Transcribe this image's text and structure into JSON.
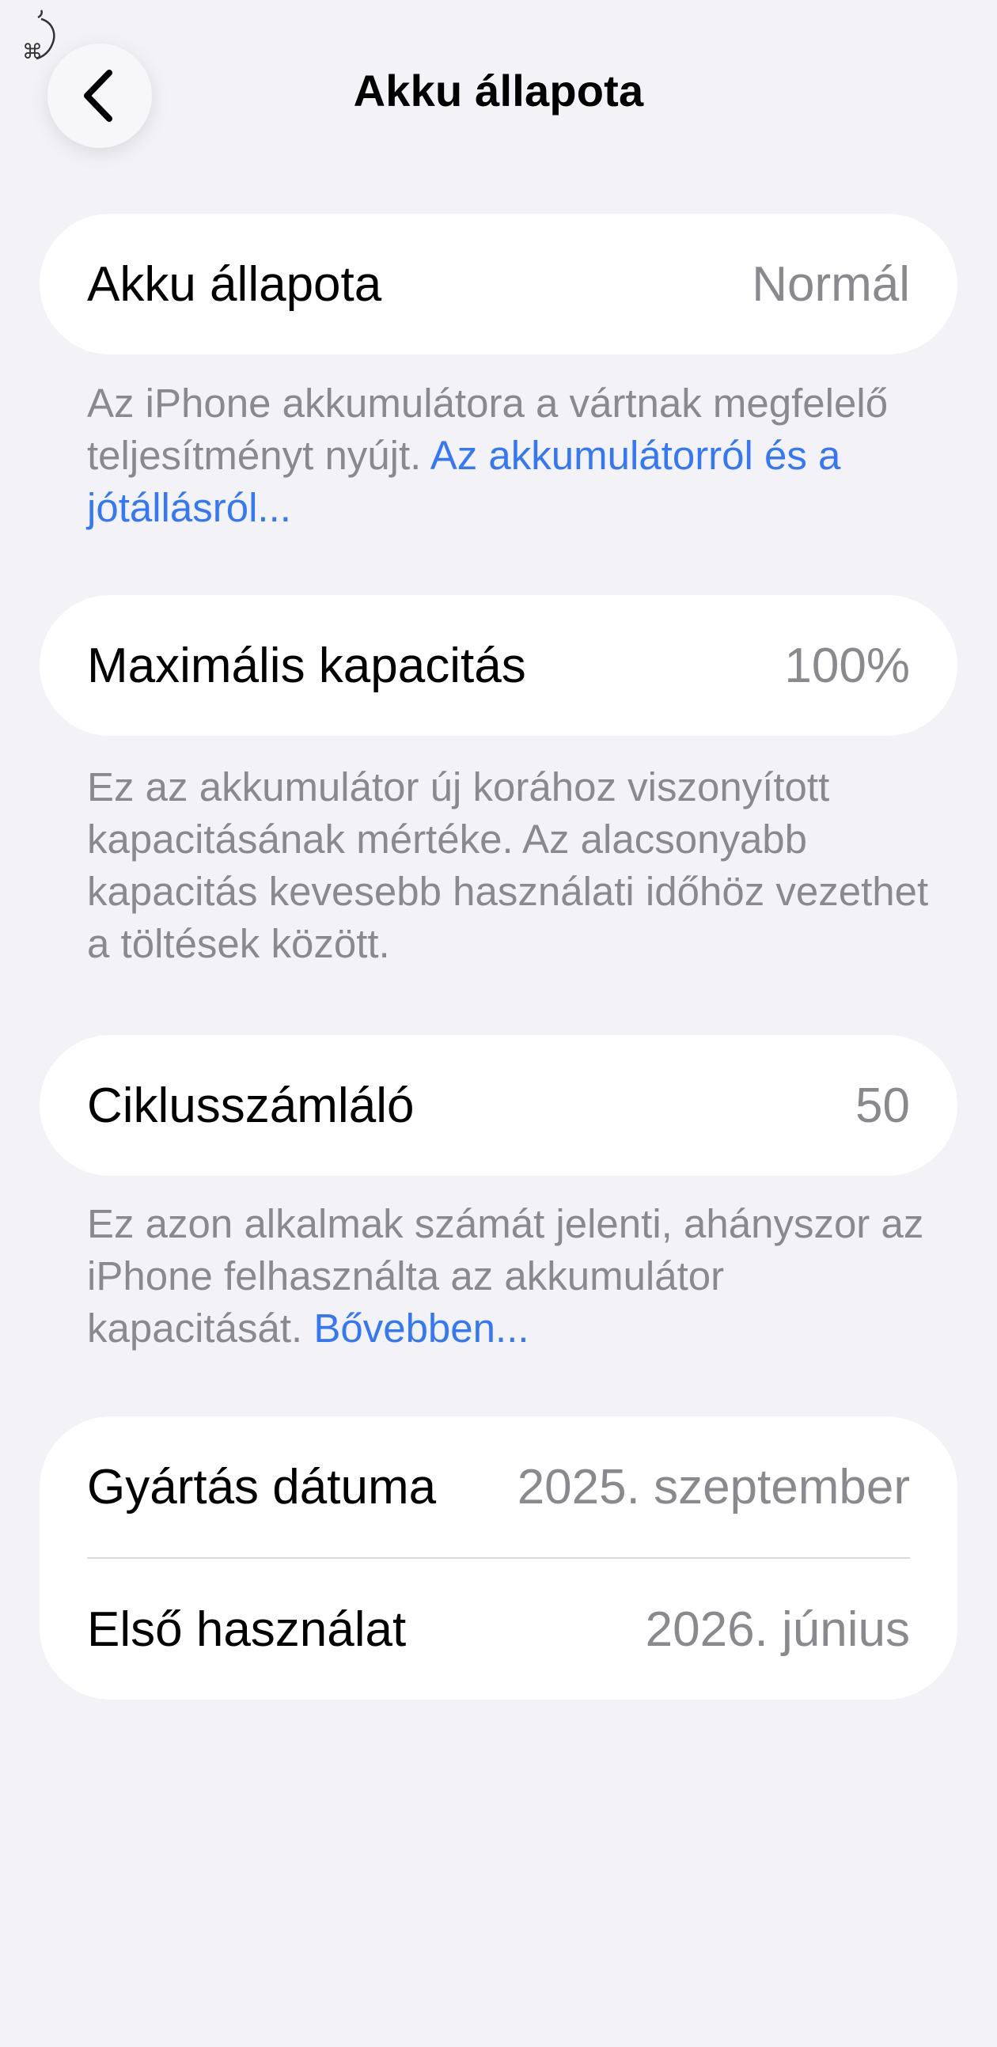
{
  "header": {
    "title": "Akku állapota",
    "back_icon": "chevron-left-icon"
  },
  "sections": {
    "health": {
      "label": "Akku állapota",
      "value": "Normál",
      "note_text": "Az iPhone akkumulátora a vártnak megfelelő teljesítményt nyújt. ",
      "note_link": "Az akkumulátorról és a jótállásról..."
    },
    "capacity": {
      "label": "Maximális kapacitás",
      "value": "100%",
      "note_text": "Ez az akkumulátor új korához viszonyított kapacitásának mértéke. Az alacsonyabb kapacitás kevesebb használati időhöz vezethet a töltések között."
    },
    "cycles": {
      "label": "Ciklusszámláló",
      "value": "50",
      "note_text": "Ez azon alkalmak számát jelenti, ahányszor az iPhone felhasználta az akkumulátor kapacitását. ",
      "note_link": "Bővebben..."
    },
    "dates": {
      "manufacture_label": "Gyártás dátuma",
      "manufacture_value": "2025. szeptember",
      "first_use_label": "Első használat",
      "first_use_value": "2026. június"
    }
  },
  "colors": {
    "background": "#f2f2f7",
    "card": "#ffffff",
    "secondary_text": "#8a8a8e",
    "link": "#3478f6"
  }
}
